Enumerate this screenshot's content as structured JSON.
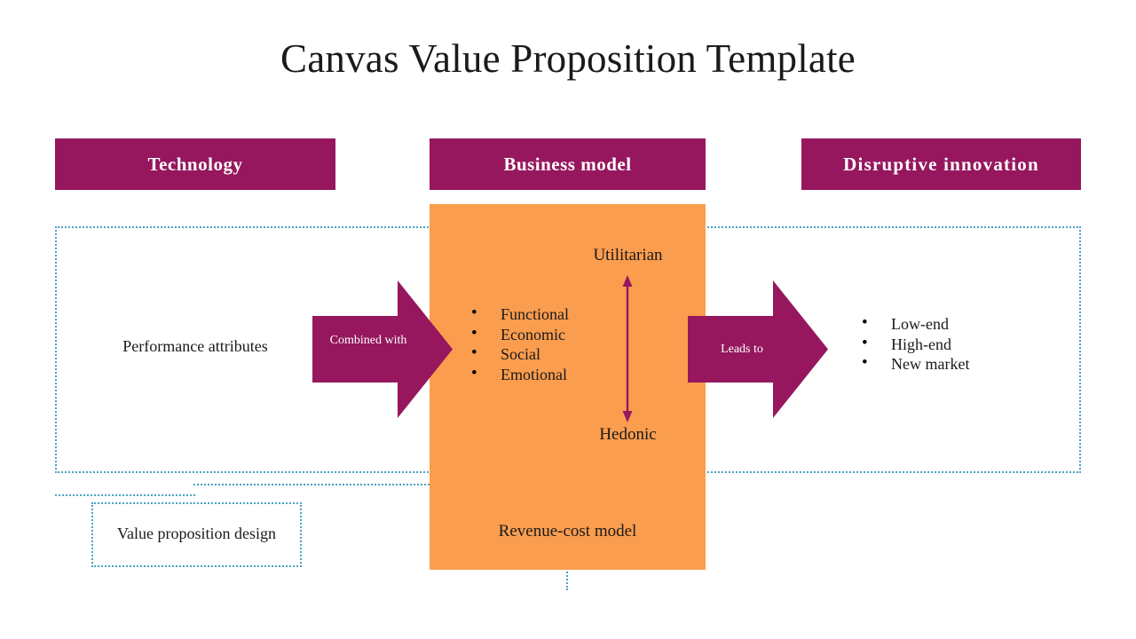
{
  "page_title": "Canvas Value Proposition Template",
  "colors": {
    "header_magenta": "#96175e",
    "panel_orange": "#fa9d4e",
    "dotted_border": "#4aa3c4",
    "arrow_magenta": "#96175e",
    "text_dark": "#1a1a1a",
    "background": "#ffffff"
  },
  "headers": {
    "technology": "Technology",
    "business_model": "Business model",
    "disruptive_innovation": "Disruptive  innovation"
  },
  "left_column": {
    "performance_attributes": "Performance attributes"
  },
  "arrows": {
    "combined_with": "Combined with",
    "leads_to": "Leads to",
    "vertical_axis": {
      "top_label": "Utilitarian",
      "bottom_label": "Hedonic",
      "direction": "double"
    }
  },
  "center_panel": {
    "value_bullets": [
      "Functional",
      "Economic",
      "Social",
      "Emotional"
    ],
    "revenue_cost_model": "Revenue-cost model"
  },
  "right_column": {
    "outcome_bullets": [
      "Low-end",
      "High-end",
      "New market"
    ]
  },
  "bottom": {
    "value_proposition_design": "Value proposition design"
  }
}
